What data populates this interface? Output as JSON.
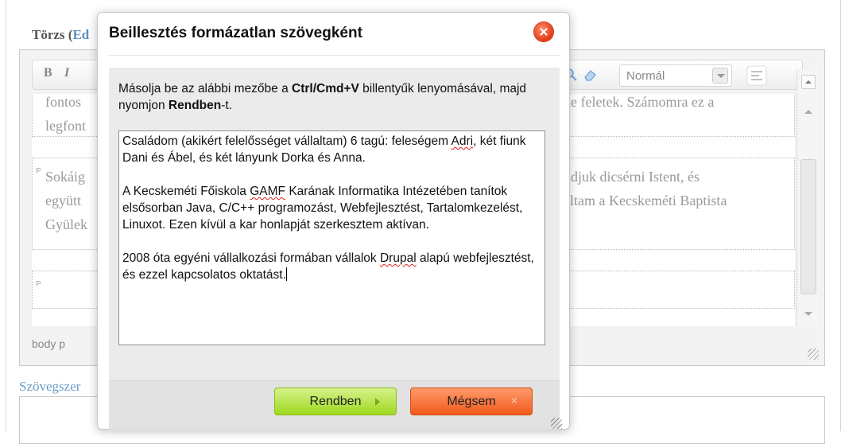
{
  "editor": {
    "field_label": "Törzs (",
    "field_label_link": "Ed",
    "toolbar": {
      "bold_label": "B",
      "italic_label": "I",
      "format_select": "Normál"
    },
    "content": {
      "para1_line1": "fontos",
      "para1_line1_right": "ke feletek. Számomra ez a",
      "para1_line2": "legfont",
      "para2_line1": "Sokáig",
      "para2_line1_right": "udjuk dicsérni Istent, és",
      "para2_line2": "együtt",
      "para2_line2_right": "áltam a Kecskeméti Baptista",
      "para2_line3": "Gyülek",
      "p_marker": "P"
    },
    "status_bar": "body  p",
    "below_label": "Szövegszer"
  },
  "dialog": {
    "title": "Beillesztés formázatlan szövegként",
    "instruction_part1": "Másolja be az alábbi mezőbe a ",
    "instruction_bold1": "Ctrl/Cmd+V",
    "instruction_part2": " billentyűk lenyomásával, majd nyomjon ",
    "instruction_bold2": "Rendben",
    "instruction_part3": "-t.",
    "textarea": {
      "p1_a": "Családom (akikért felelősséget vállaltam) 6 tagú: feleségem ",
      "p1_squig": "Adri",
      "p1_b": ", két fiunk Dani és Ábel, és két lányunk Dorka és Anna.",
      "p2_a": "A Kecskeméti Főiskola ",
      "p2_squig": "GAMF",
      "p2_b": " Karának Informatika Intézetében tanítok elsősorban Java, C/C++ programozást, Webfejlesztést, Tartalomkezelést, Linuxot. Ezen kívül a kar honlapját szerkesztem aktívan.",
      "p3_a": "2008 óta egyéni vállalkozási formában vállalok ",
      "p3_squig": "Drupal",
      "p3_b": " alapú webfejlesztést, és ezzel kapcsolatos oktatást."
    },
    "ok_label": "Rendben",
    "cancel_label": "Mégsem",
    "cancel_x": "×"
  },
  "colors": {
    "ok_button": "#9fd81f",
    "cancel_button": "#f05a1c",
    "close_button": "#e23b16",
    "link": "#5b8fbf"
  },
  "icons": [
    "close-icon",
    "eraser-icon",
    "search-icon",
    "scroll-up-icon",
    "scroll-down-icon",
    "resize-grip-icon",
    "arrow-right-icon"
  ]
}
